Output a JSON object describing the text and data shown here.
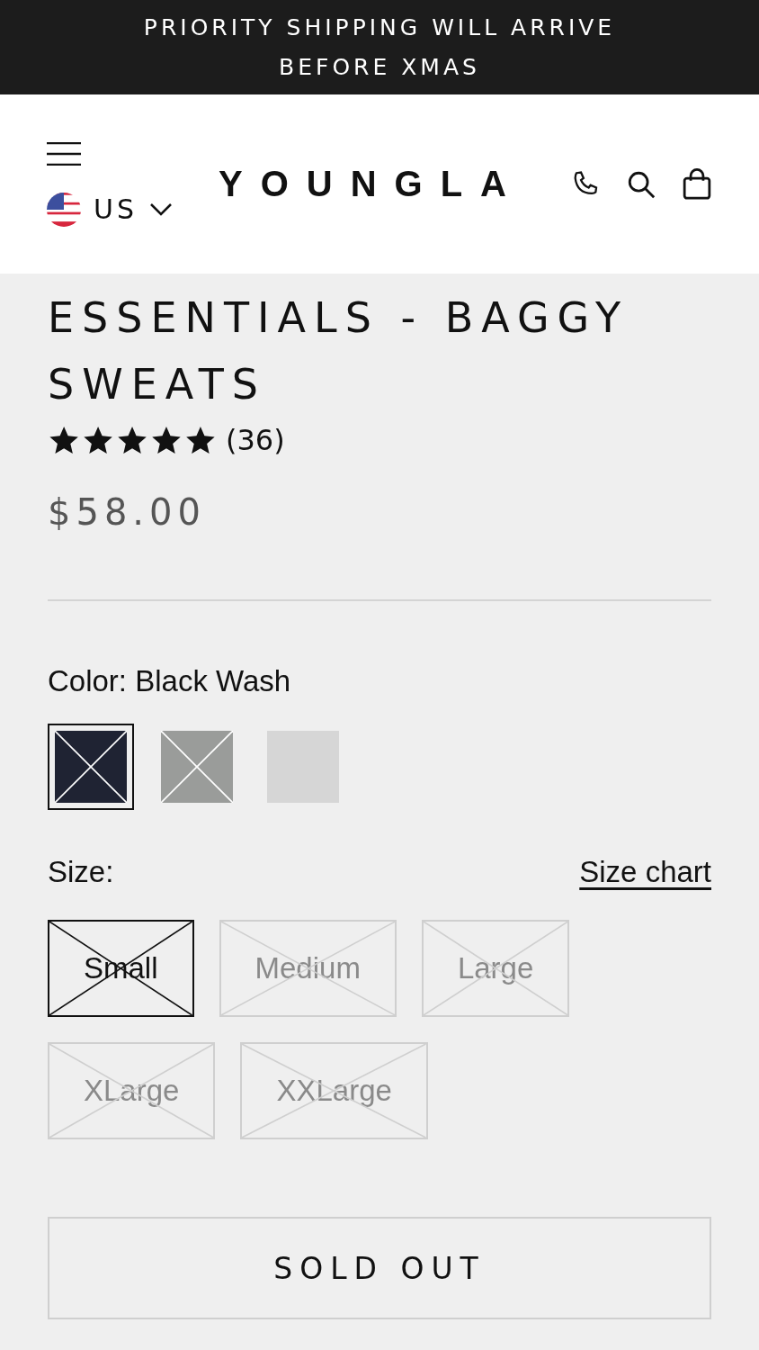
{
  "announcement": {
    "lines": [
      "PRIORITY SHIPPING WILL ARRIVE",
      "BEFORE XMAS"
    ]
  },
  "header": {
    "logo": "YOUNGLA",
    "country": "US"
  },
  "product": {
    "title": "ESSENTIALS - BAGGY SWEATS",
    "stars": 5,
    "review_count": "(36)",
    "price": "$58.00"
  },
  "color": {
    "label": "Color:",
    "value": "Black Wash",
    "swatches": [
      {
        "color": "#1f2333",
        "selected": true,
        "sold_out": true
      },
      {
        "color": "#9a9c9a",
        "selected": false,
        "sold_out": true
      },
      {
        "color": "#d6d6d6",
        "selected": false,
        "sold_out": false
      }
    ]
  },
  "size": {
    "label": "Size:",
    "chart_link": "Size chart",
    "options": [
      {
        "label": "Small",
        "selected": true,
        "sold_out": true
      },
      {
        "label": "Medium",
        "selected": false,
        "sold_out": true
      },
      {
        "label": "Large",
        "selected": false,
        "sold_out": true
      },
      {
        "label": "XLarge",
        "selected": false,
        "sold_out": true
      },
      {
        "label": "XXLarge",
        "selected": false,
        "sold_out": true
      }
    ]
  },
  "buy_button": {
    "label": "SOLD OUT",
    "disabled": true
  }
}
